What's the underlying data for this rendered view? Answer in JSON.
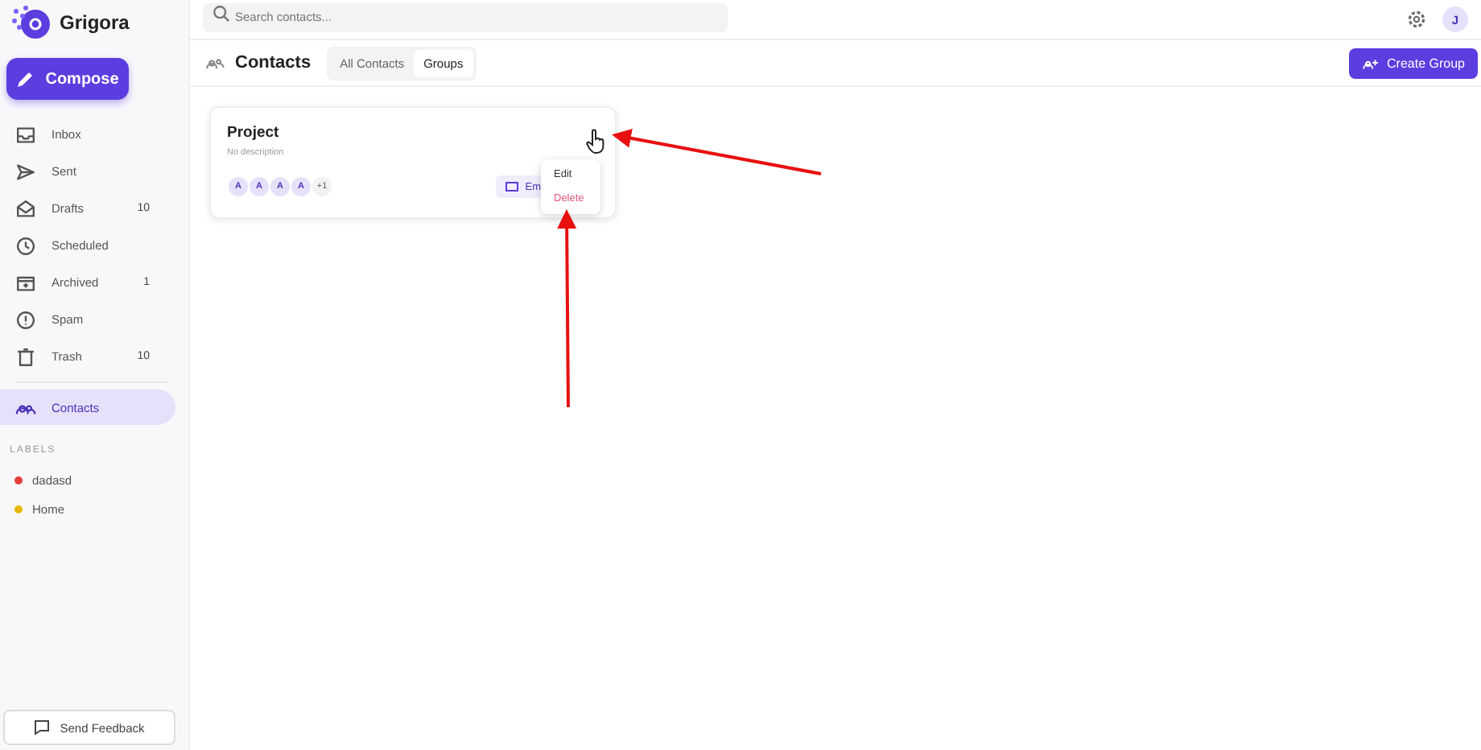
{
  "brand": {
    "name": "Grigora"
  },
  "compose": {
    "label": "Compose"
  },
  "nav": [
    {
      "label": "Inbox",
      "selected": false
    },
    {
      "label": "Sent",
      "selected": false
    },
    {
      "label": "Drafts",
      "count": "10",
      "selected": false
    },
    {
      "label": "Scheduled",
      "selected": false
    },
    {
      "label": "Archived",
      "count": "1",
      "selected": false
    },
    {
      "label": "Spam",
      "selected": false
    },
    {
      "label": "Trash",
      "count": "10",
      "selected": false
    },
    {
      "label": "Contacts",
      "selected": true
    }
  ],
  "labels": {
    "heading": "LABELS",
    "items": [
      {
        "label": "dadasd",
        "color": "#e53e3e"
      },
      {
        "label": "Home",
        "color": "#e6b800"
      }
    ]
  },
  "feedback": {
    "label": "Send Feedback"
  },
  "search": {
    "placeholder": "Search contacts..."
  },
  "avatar": {
    "initial": "J"
  },
  "header": {
    "title": "Contacts",
    "tabs": [
      {
        "label": "All Contacts",
        "selected": false
      },
      {
        "label": "Groups",
        "selected": true
      }
    ],
    "create": "Create Group"
  },
  "group": {
    "name": "Project",
    "description": "No description",
    "members": [
      "A",
      "A",
      "A",
      "A"
    ],
    "more": "+1",
    "email_button": "Em"
  },
  "menu": {
    "items": [
      {
        "label": "Edit",
        "kind": "normal"
      },
      {
        "label": "Delete",
        "kind": "danger"
      }
    ]
  }
}
